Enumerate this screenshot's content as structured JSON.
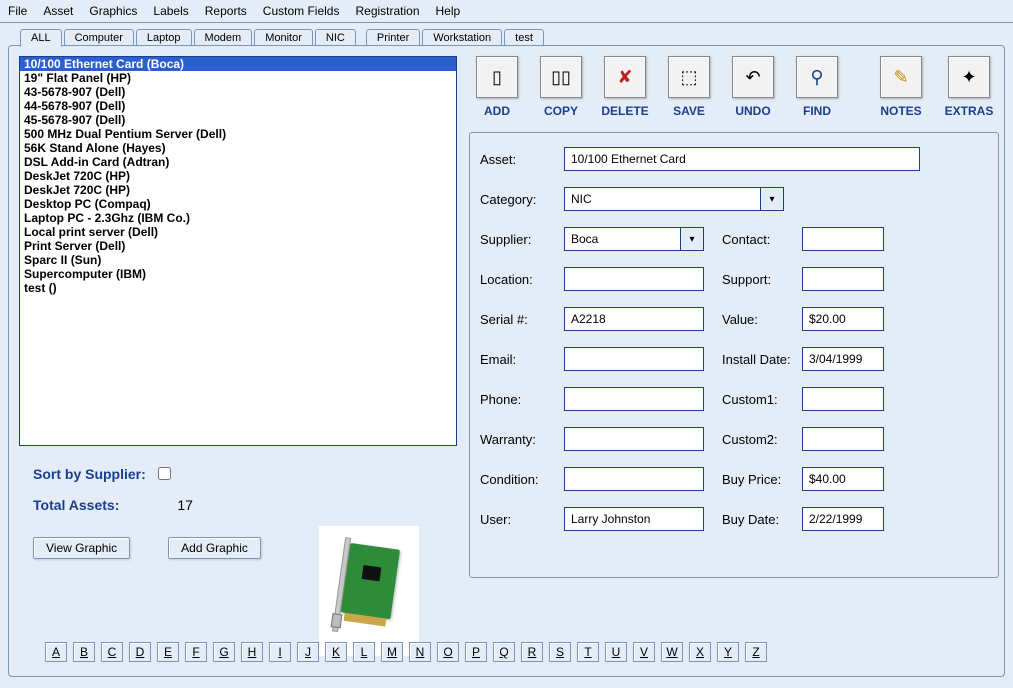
{
  "menu": [
    "File",
    "Asset",
    "Graphics",
    "Labels",
    "Reports",
    "Custom Fields",
    "Registration",
    "Help"
  ],
  "tabs": [
    "ALL",
    "Computer",
    "Laptop",
    "Modem",
    "Monitor",
    "NIC",
    "Printer",
    "Workstation",
    "test"
  ],
  "active_tab": "ALL",
  "assets": [
    "10/100 Ethernet Card (Boca)",
    "19\" Flat Panel (HP)",
    "43-5678-907 (Dell)",
    "44-5678-907 (Dell)",
    "45-5678-907 (Dell)",
    "500 MHz Dual Pentium Server (Dell)",
    "56K Stand Alone (Hayes)",
    "DSL Add-in Card (Adtran)",
    "DeskJet 720C (HP)",
    "DeskJet 720C (HP)",
    "Desktop PC (Compaq)",
    "Laptop PC - 2.3Ghz (IBM Co.)",
    "Local print server (Dell)",
    "Print Server (Dell)",
    "Sparc II (Sun)",
    "Supercomputer (IBM)",
    "test ()"
  ],
  "selected_asset_index": 0,
  "sort_label": "Sort by Supplier:",
  "sort_checked": false,
  "total_label": "Total Assets:",
  "total_value": "17",
  "btn_view_graphic": "View Graphic",
  "btn_add_graphic": "Add Graphic",
  "toolbar": [
    {
      "id": "add",
      "label": "ADD",
      "glyph": "▯"
    },
    {
      "id": "copy",
      "label": "COPY",
      "glyph": "▯▯"
    },
    {
      "id": "delete",
      "label": "DELETE",
      "glyph": "✘",
      "color": "#c02020"
    },
    {
      "id": "save",
      "label": "SAVE",
      "glyph": "⬚"
    },
    {
      "id": "undo",
      "label": "UNDO",
      "glyph": "↶"
    },
    {
      "id": "find",
      "label": "FIND",
      "glyph": "⚲",
      "color": "#1b3f8f"
    },
    {
      "id": "notes",
      "label": "NOTES",
      "glyph": "✎",
      "color": "#c88a00"
    },
    {
      "id": "extras",
      "label": "EXTRAS",
      "glyph": "✦"
    }
  ],
  "form": {
    "asset_label": "Asset:",
    "asset": "10/100 Ethernet Card",
    "category_label": "Category:",
    "category": "NIC",
    "supplier_label": "Supplier:",
    "supplier": "Boca",
    "contact_label": "Contact:",
    "contact": "",
    "location_label": "Location:",
    "location": "",
    "support_label": "Support:",
    "support": "",
    "serial_label": "Serial #:",
    "serial": "A2218",
    "value_label": "Value:",
    "value": "$20.00",
    "email_label": "Email:",
    "email": "",
    "install_label": "Install Date:",
    "install": "3/04/1999",
    "phone_label": "Phone:",
    "phone": "",
    "custom1_label": "Custom1:",
    "custom1": "",
    "warranty_label": "Warranty:",
    "warranty": "",
    "custom2_label": "Custom2:",
    "custom2": "",
    "condition_label": "Condition:",
    "condition": "",
    "buyprice_label": "Buy Price:",
    "buyprice": "$40.00",
    "user_label": "User:",
    "user": "Larry Johnston",
    "buydate_label": "Buy Date:",
    "buydate": "2/22/1999"
  },
  "alphabet": [
    "A",
    "B",
    "C",
    "D",
    "E",
    "F",
    "G",
    "H",
    "I",
    "J",
    "K",
    "L",
    "M",
    "N",
    "O",
    "P",
    "Q",
    "R",
    "S",
    "T",
    "U",
    "V",
    "W",
    "X",
    "Y",
    "Z"
  ]
}
